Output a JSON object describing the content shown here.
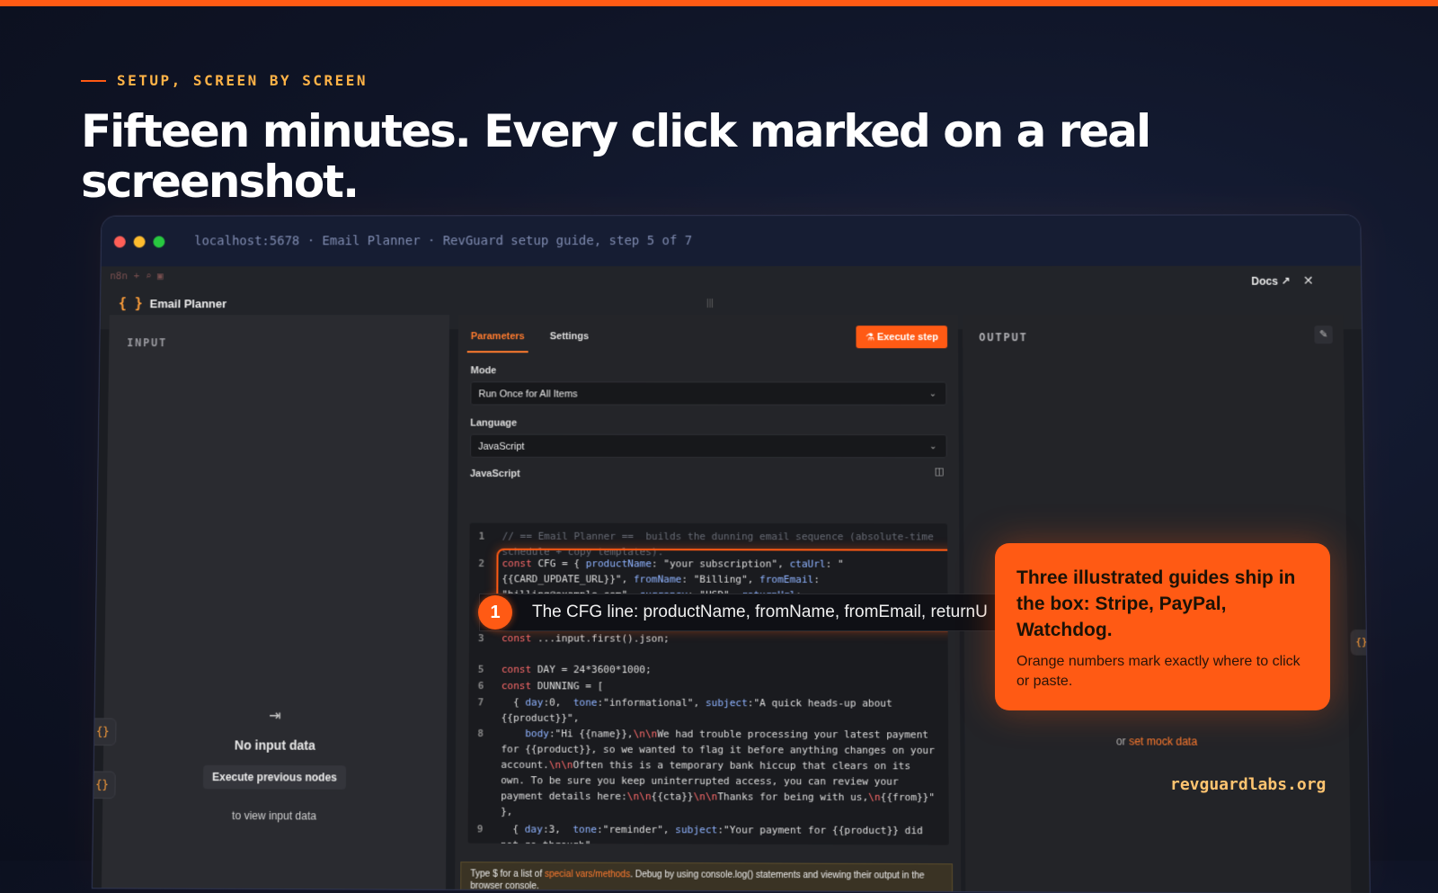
{
  "eyebrow": "SETUP, SCREEN BY SCREEN",
  "headline": "Fifteen minutes. Every click marked on a real screenshot.",
  "browser": {
    "url": "localhost:5678 · Email Planner · RevGuard setup guide, step 5 of 7",
    "dot_colors": [
      "#ff5f57",
      "#febc2e",
      "#28c840"
    ]
  },
  "app": {
    "tab_icons": "n8n  +  ⌕  ▣",
    "node_name": "Email Planner",
    "docs_label": "Docs",
    "close_label": "✕",
    "handle": "|||"
  },
  "input_panel": {
    "title": "INPUT",
    "empty_title": "No input data",
    "execute_prev_label": "Execute previous nodes",
    "sub_text": "to view input data"
  },
  "params_panel": {
    "tab_parameters": "Parameters",
    "tab_settings": "Settings",
    "execute_label": "Execute step",
    "mode_label": "Mode",
    "mode_value": "Run Once for All Items",
    "language_label": "Language",
    "language_value": "JavaScript",
    "code_label": "JavaScript",
    "code_lines": [
      {
        "n": "1",
        "html": "<span class='cm'>// == Email Planner ==  builds the dunning email sequence (absolute-time schedule + copy templates).</span>"
      },
      {
        "n": "2",
        "html": "<span class='kw'>const</span> CFG = { <span class='pr'>productName</span>: \"your subscription\", <span class='pr'>ctaUrl</span>: \"{{CARD_UPDATE_URL}}\", <span class='pr'>fromName</span>: \"Billing\", <span class='pr'>fromEmail</span>: \"billing@example.com\", <span class='pr'>currency</span>: \"USD\", <span class='pr'>returnUrl</span>: \"https://example.com/account\" };  <span class='cm'>// returnUrl = where Stripe's portal returns the customer (buyer edits)</span>"
      },
      {
        "n": "3",
        "html": "<span class='kw'>const</span> ...input.first().json;"
      },
      {
        "n": "5",
        "html": "<span class='kw'>const</span> DAY = 24*3600*1000;"
      },
      {
        "n": "6",
        "html": "<span class='kw'>const</span> DUNNING = ["
      },
      {
        "n": "7",
        "html": "  { <span class='pr'>day</span>:0,  <span class='pr'>tone</span>:\"informational\", <span class='pr'>subject</span>:\"A quick heads-up about {{product}}\","
      },
      {
        "n": "8",
        "html": "    <span class='pr'>body</span>:\"Hi {{name}},<span class='kw'>\\n\\n</span>We had trouble processing your latest payment for {{product}}, so we wanted to flag it before anything changes on your account.<span class='kw'>\\n\\n</span>Often this is a temporary bank hiccup that clears on its own. To be sure you keep uninterrupted access, you can review your payment details here:<span class='kw'>\\n\\n</span>{{cta}}<span class='kw'>\\n\\n</span>Thanks for being with us,<span class='kw'>\\n</span>{{from}}\" },"
      },
      {
        "n": "9",
        "html": "  { <span class='pr'>day</span>:3,  <span class='pr'>tone</span>:\"reminder\", <span class='pr'>subject</span>:\"Your payment for {{product}} did not go through\","
      }
    ],
    "hint_pre": "Type $ for a list of ",
    "hint_link": "special vars/methods",
    "hint_post": ". Debug by using console.log() statements and viewing their output in the browser console."
  },
  "output_panel": {
    "title": "OUTPUT",
    "mock_pre": "or ",
    "mock_link": "set mock data"
  },
  "callout": {
    "heading": "Three illustrated guides ship in the box: Stripe, PayPal, Watchdog.",
    "sub": "Orange numbers mark exactly where to click or paste."
  },
  "tooltip": {
    "number": "1",
    "text": "The CFG line: productName, fromName, fromEmail, returnU"
  },
  "site": "revguardlabs.org",
  "colors": {
    "accent": "#ff5a14",
    "eyebrow": "#ffb347",
    "site": "#ffc470"
  }
}
